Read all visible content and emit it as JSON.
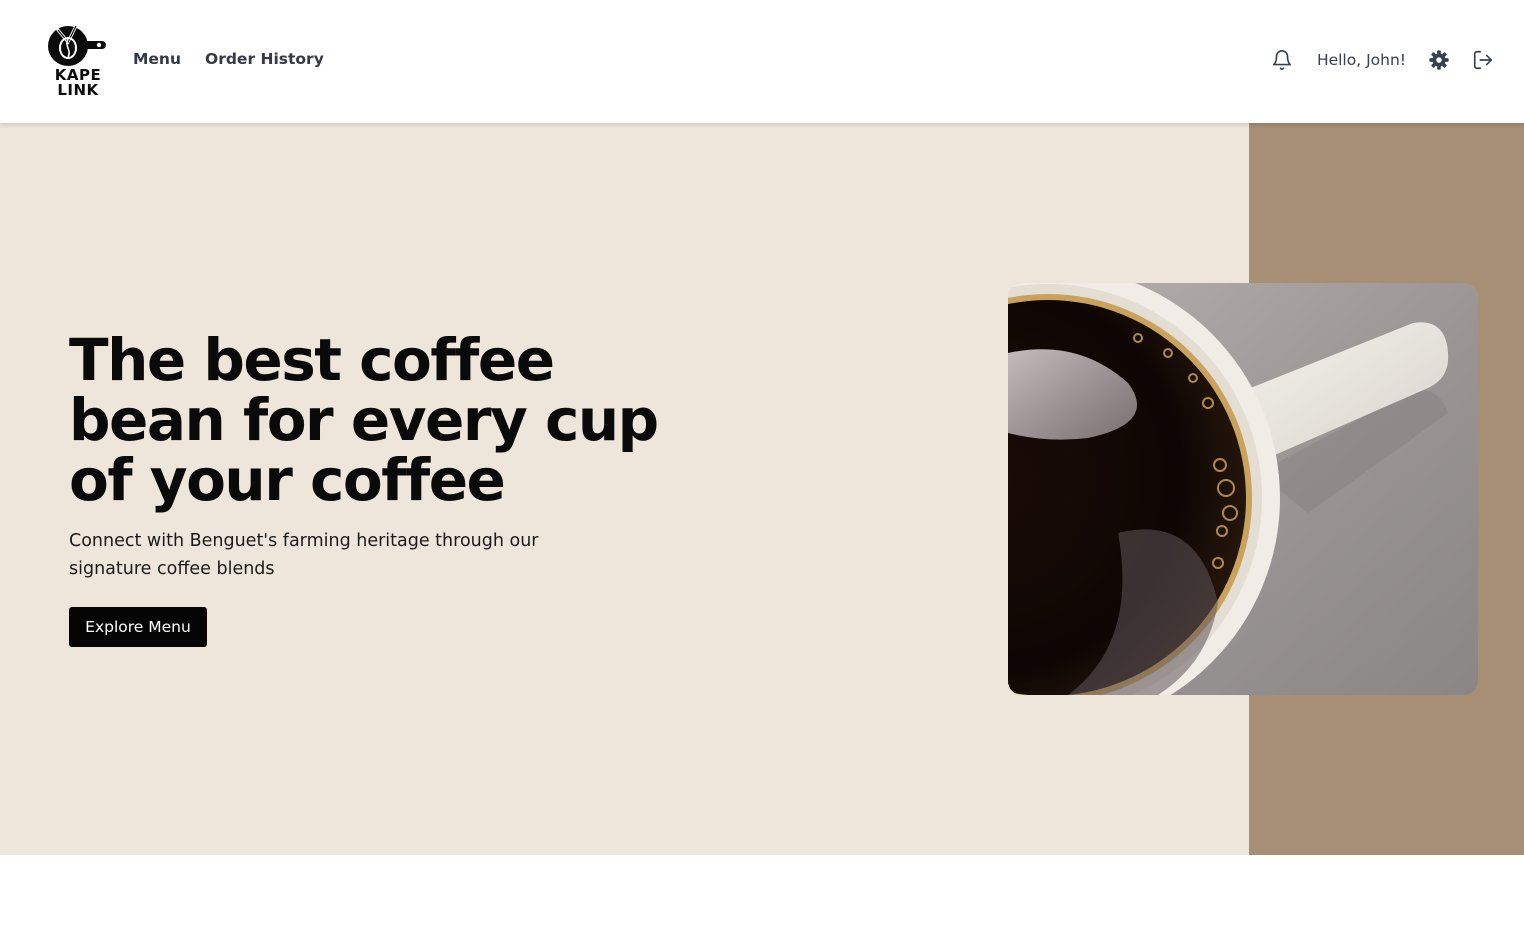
{
  "brand": {
    "logo_text_line1": "KAPE",
    "logo_text_line2": "LINK"
  },
  "nav": {
    "items": [
      {
        "label": "Menu"
      },
      {
        "label": "Order History"
      }
    ]
  },
  "header_right": {
    "greeting": "Hello, John!",
    "icons": [
      "bell-icon",
      "gear-icon",
      "logout-icon"
    ]
  },
  "hero": {
    "headline": "The best coffee bean for every cup of your coffee",
    "subtext": "Connect with Benguet's farming heritage through our signature coffee blends",
    "cta_label": "Explore Menu",
    "image_subject": "coffee-cup-image"
  },
  "colors": {
    "hero_background": "#eee5db",
    "accent_strip": "#a68f74",
    "button": "#050505",
    "nav_text": "#343a48"
  }
}
